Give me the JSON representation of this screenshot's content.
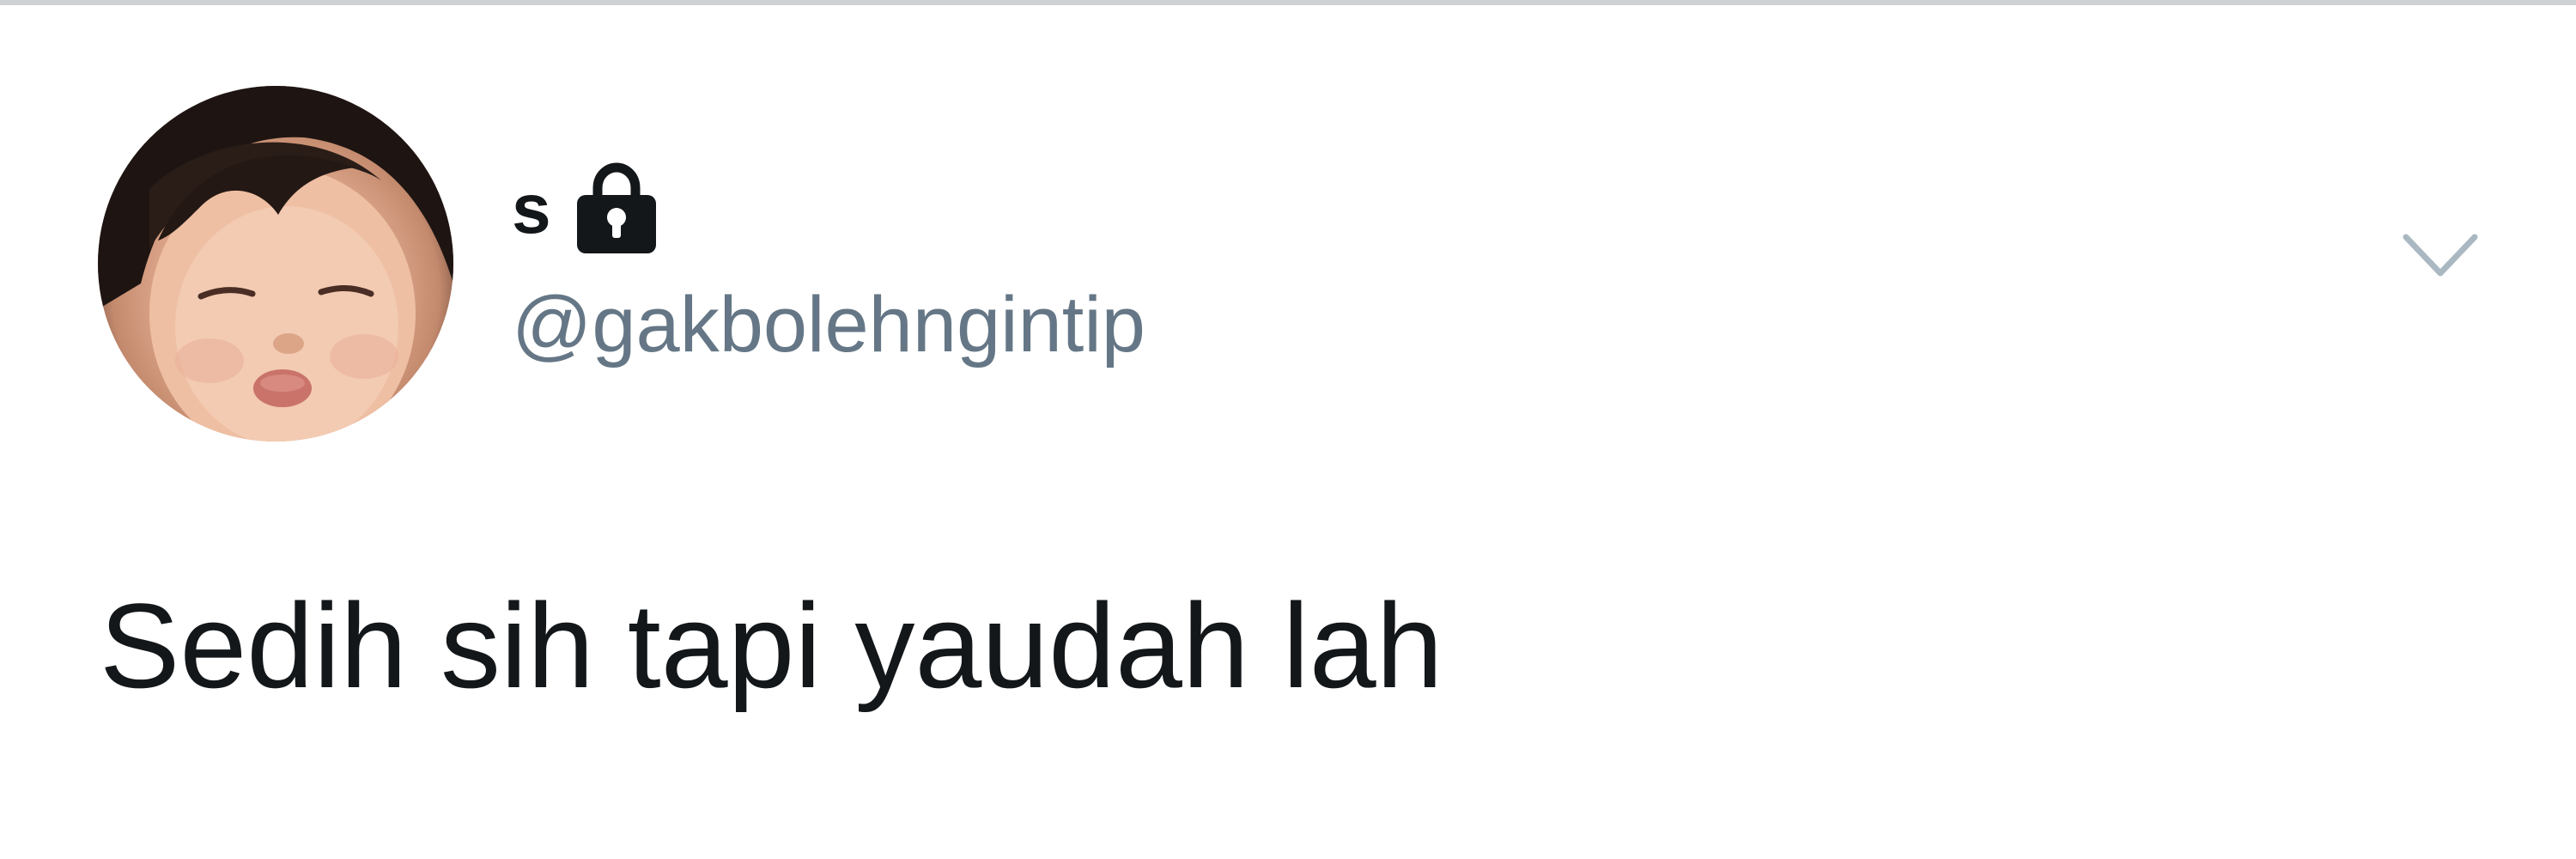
{
  "tweet": {
    "avatar_icon": "avatar-photo",
    "display_name": "s",
    "protected_icon": "lock-icon",
    "handle": "@gakbolehngintip",
    "menu_icon": "chevron-down-icon",
    "text": "Sedih sih tapi yaudah lah"
  },
  "colors": {
    "text_primary": "#14171a",
    "text_secondary": "#657786",
    "chevron": "#aab8c2",
    "divider": "#cfd2d5"
  }
}
